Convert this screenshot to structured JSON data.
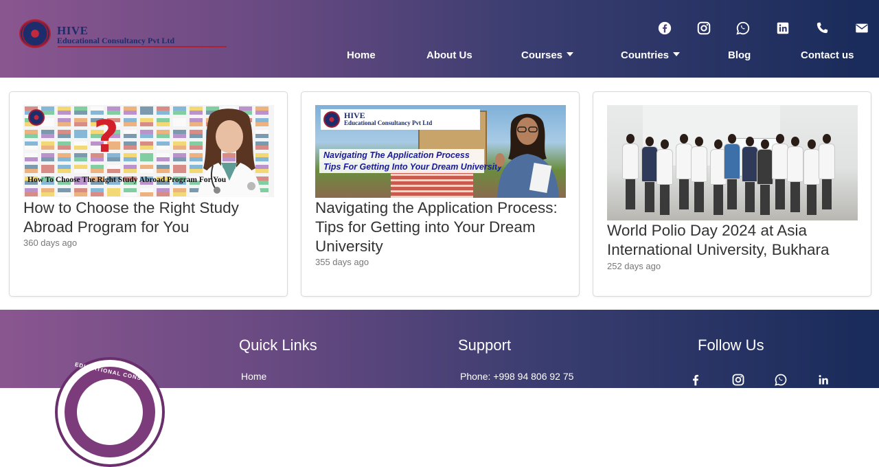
{
  "header": {
    "logo": {
      "name": "HIVE",
      "subtitle": "Educational Consultancy Pvt Ltd"
    },
    "social_icons": [
      "facebook-icon",
      "instagram-icon",
      "whatsapp-icon",
      "linkedin-icon",
      "phone-icon",
      "mail-icon"
    ],
    "nav": [
      {
        "label": "Home",
        "dropdown": false
      },
      {
        "label": "About Us",
        "dropdown": false
      },
      {
        "label": "Courses",
        "dropdown": true
      },
      {
        "label": "Countries",
        "dropdown": true
      },
      {
        "label": "Blog",
        "dropdown": false
      },
      {
        "label": "Contact us",
        "dropdown": false
      }
    ]
  },
  "cards": [
    {
      "title": "How to Choose the Right Study Abroad Program for You",
      "date": "360 days ago",
      "image_caption": "How To Choose The Right Study Abroad Program For You"
    },
    {
      "title": "Navigating the Application Process: Tips for Getting into Your Dream University",
      "date": "355 days ago",
      "image_brand": "HIVE",
      "image_brand_sub": "Educational Consultancy Pvt Ltd",
      "image_line1": "Navigating The Application Process",
      "image_line2": "Tips For Getting Into Your Dream University"
    },
    {
      "title": "World Polio Day 2024 at Asia International University, Bukhara",
      "date": "252 days ago"
    }
  ],
  "footer": {
    "logo_text": "EDUCATIONAL CONSU",
    "quick_links": {
      "heading": "Quick Links",
      "items": [
        "Home"
      ]
    },
    "support": {
      "heading": "Support",
      "phone": "Phone: +998 94 806 92 75"
    },
    "follow": {
      "heading": "Follow Us",
      "icons": [
        "facebook-icon",
        "instagram-icon",
        "whatsapp-icon",
        "linkedin-icon"
      ]
    }
  },
  "colors": {
    "gradient_start": "#8a5690",
    "gradient_end": "#182b5a",
    "brand_navy": "#1d2c6b",
    "brand_red": "#b02035"
  }
}
